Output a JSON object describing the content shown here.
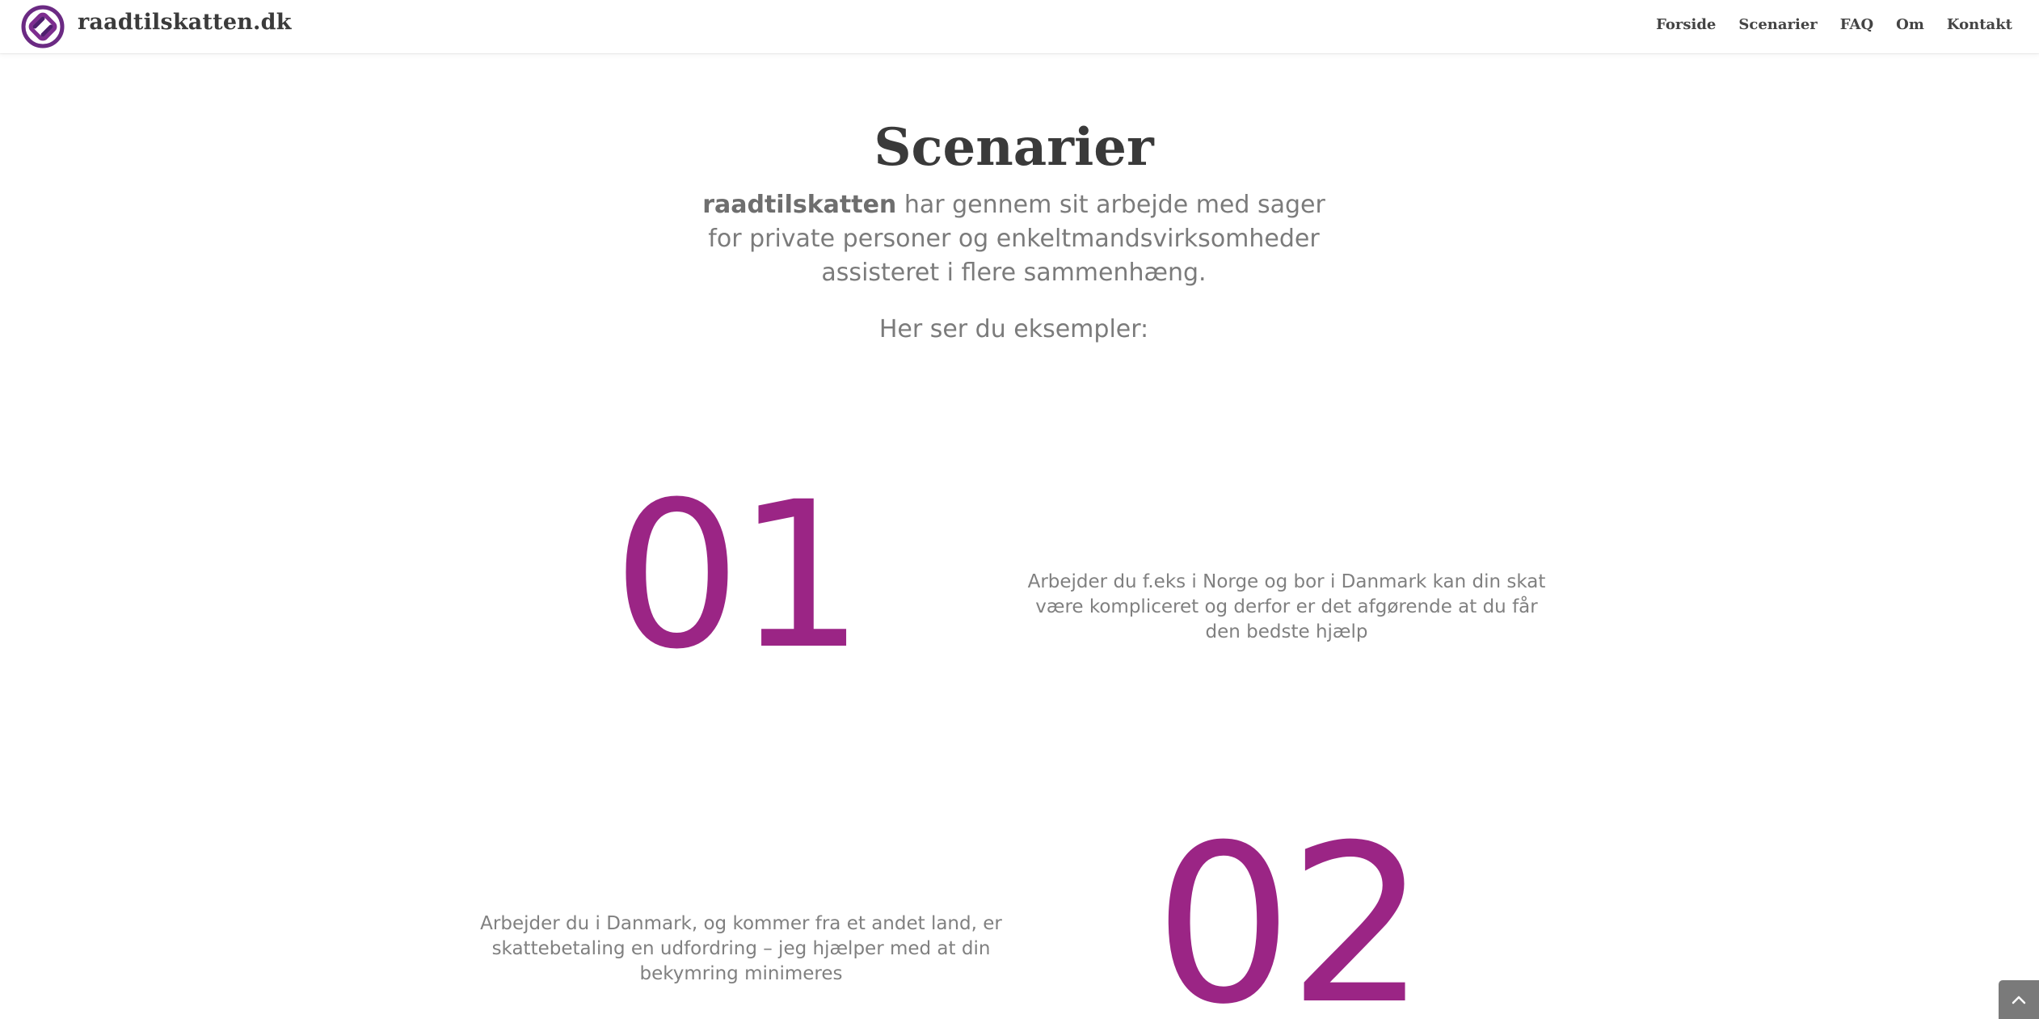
{
  "header": {
    "site_title": "raadtilskatten.dk",
    "logo_icon": "knot-logo-icon",
    "nav": [
      "Forside",
      "Scenarier",
      "FAQ",
      "Om",
      "Kontakt"
    ]
  },
  "intro": {
    "title": "Scenarier",
    "text_bold": "raadtilskatten",
    "text_rest": " har gennem sit arbejde med sager for private personer og enkeltmandsvirksomheder assisteret i flere sammenhæng.",
    "sub": "Her ser du eksempler:"
  },
  "scenarios": [
    {
      "number": "01",
      "text": "Arbejder du f.eks i Norge og bor i Danmark kan din skat være kompliceret og derfor er det afgørende at du får den bedste hjælp"
    },
    {
      "number": "02",
      "text": "Arbejder du i Danmark, og kommer fra et andet land, er skattebetaling en udfordring – jeg hjælper med at din bekymring minimeres"
    }
  ],
  "back_to_top_icon": "chevron-up-icon",
  "colors": {
    "accent": "#9b2585",
    "title": "#3a3a3a",
    "body_text": "#7b7b7b"
  }
}
